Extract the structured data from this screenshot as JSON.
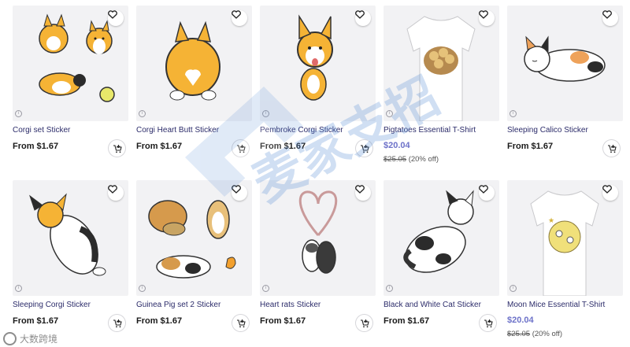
{
  "products": [
    {
      "title": "Corgi set Sticker",
      "price": "From $1.67",
      "icon": "corgi-set-image"
    },
    {
      "title": "Corgi Heart Butt Sticker",
      "price": "From $1.67",
      "icon": "corgi-butt-image"
    },
    {
      "title": "Pembroke Corgi Sticker",
      "price": "From $1.67",
      "icon": "pembroke-corgi-image"
    },
    {
      "title": "Pigtatoes Essential T-Shirt",
      "price": "$20.04",
      "original_price": "$25.05",
      "discount": "(20% off)",
      "icon": "pigtatoes-tshirt-image"
    },
    {
      "title": "Sleeping Calico Sticker",
      "price": "From $1.67",
      "icon": "calico-cat-image"
    },
    {
      "title": "Sleeping Corgi Sticker",
      "price": "From $1.67",
      "icon": "sleeping-corgi-image"
    },
    {
      "title": "Guinea Pig set 2 Sticker",
      "price": "From $1.67",
      "icon": "guinea-pig-image"
    },
    {
      "title": "Heart rats Sticker",
      "price": "From $1.67",
      "icon": "heart-rats-image"
    },
    {
      "title": "Black and White Cat Sticker",
      "price": "From $1.67",
      "icon": "bw-cat-image"
    },
    {
      "title": "Moon Mice Essential T-Shirt",
      "price": "$20.04",
      "original_price": "$25.05",
      "discount": "(20% off)",
      "icon": "moon-mice-tshirt-image"
    }
  ],
  "watermark": {
    "text": "麦家支招"
  },
  "corner_watermark": {
    "text": "大数跨境"
  },
  "colors": {
    "sale_price": "#6d72c9",
    "title": "#2c2c6a",
    "thumb_bg": "#f2f2f4",
    "corgi": "#f5b335"
  }
}
